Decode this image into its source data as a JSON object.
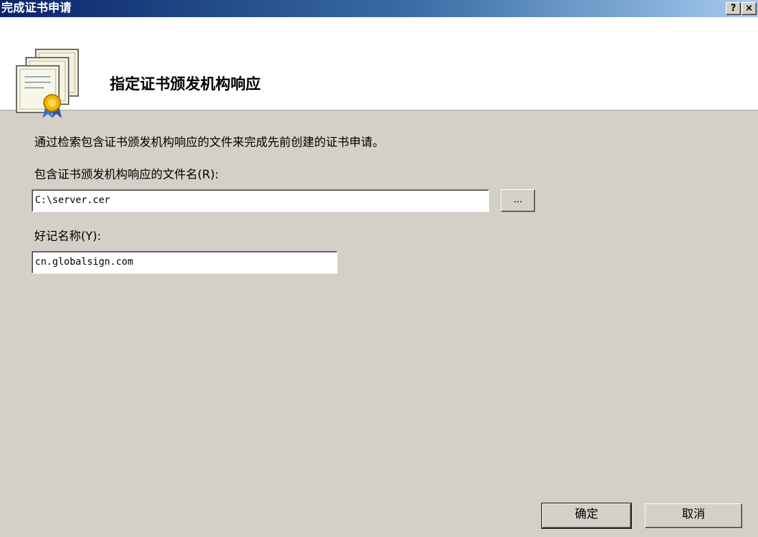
{
  "window": {
    "title": "完成证书申请",
    "help_label": "?",
    "close_label": "×"
  },
  "header": {
    "title": "指定证书颁发机构响应",
    "icon": "certificate-icon"
  },
  "content": {
    "description": "通过检索包含证书颁发机构响应的文件来完成先前创建的证书申请。",
    "file_label": "包含证书颁发机构响应的文件名(R):",
    "file_value": "C:\\server.cer",
    "browse_label": "...",
    "friendly_name_label": "好记名称(Y):",
    "friendly_name_value": "cn.globalsign.com"
  },
  "buttons": {
    "ok_label": "确定",
    "cancel_label": "取消"
  },
  "colors": {
    "titlebar_start": "#0a246a",
    "titlebar_end": "#a6caf0",
    "dialog_bg": "#d4d0c8"
  }
}
